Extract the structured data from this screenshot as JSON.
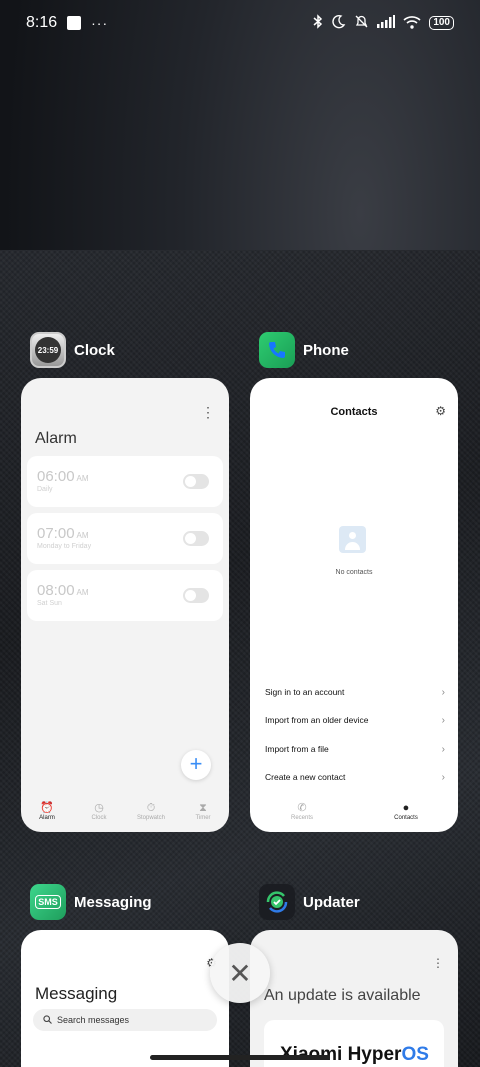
{
  "status_bar": {
    "time": "8:16",
    "dots": "···",
    "battery": "100",
    "icons": [
      "bluetooth-icon",
      "moon-icon",
      "bell-off-icon",
      "signal-icon",
      "wifi-icon"
    ]
  },
  "apps": {
    "clock": {
      "name": "Clock",
      "icon_text": "23:59",
      "title": "Alarm",
      "alarms": [
        {
          "time": "06:00",
          "ampm": "AM",
          "repeat": "Daily"
        },
        {
          "time": "07:00",
          "ampm": "AM",
          "repeat": "Monday to Friday"
        },
        {
          "time": "08:00",
          "ampm": "AM",
          "repeat": "Sat Sun"
        }
      ],
      "add_label": "+",
      "nav": [
        "Alarm",
        "Clock",
        "Stopwatch",
        "Timer"
      ]
    },
    "phone": {
      "name": "Phone",
      "title": "Contacts",
      "empty_text": "No contacts",
      "actions": [
        "Sign in to an account",
        "Import from an older device",
        "Import from a file",
        "Create a new contact"
      ],
      "nav": [
        "Recents",
        "Contacts"
      ]
    },
    "messaging": {
      "name": "Messaging",
      "icon_text": "SMS",
      "title": "Messaging",
      "search_placeholder": "Search messages"
    },
    "updater": {
      "name": "Updater",
      "title": "An update is available",
      "brand_main": "Xiaomi Hyper",
      "brand_accent": "OS"
    }
  },
  "colors": {
    "accent": "#3a8ef6",
    "phone_green": "#1fae5b",
    "sms_green": "#2fb36e"
  }
}
